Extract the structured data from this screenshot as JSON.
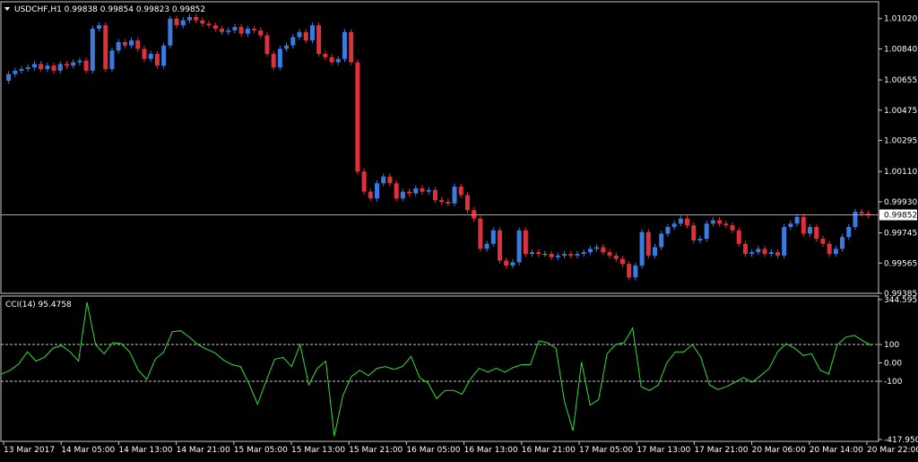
{
  "symbol_header": "USDCHF,H1  0.99838 0.99854 0.99823 0.99852",
  "menu_icon": "triangle-down-icon",
  "indicator_header": "CCI(14) 95.4758",
  "colors": {
    "background": "#000000",
    "bull": "#3a7be0",
    "bear": "#e0303a",
    "doji": "#34c334",
    "cci_line": "#33dd33",
    "grid_border": "#c8c8c8",
    "price_line": "#9aa7b8",
    "price_tag_bg": "#ffffff",
    "price_tag_text": "#000000"
  },
  "chart_data": [
    {
      "type": "candlestick",
      "title": "USDCHF,H1",
      "ylim": [
        0.99385,
        1.0112
      ],
      "y_ticks": [
        "1.01020",
        "1.00840",
        "1.00655",
        "1.00475",
        "1.00295",
        "1.00110",
        "0.99930",
        "0.99745",
        "0.99565",
        "0.99385"
      ],
      "current_price": "0.99852",
      "x_ticks": [
        "13 Mar 2017",
        "14 Mar 05:00",
        "14 Mar 13:00",
        "14 Mar 21:00",
        "15 Mar 05:00",
        "15 Mar 13:00",
        "15 Mar 21:00",
        "16 Mar 05:00",
        "16 Mar 13:00",
        "16 Mar 21:00",
        "17 Mar 05:00",
        "17 Mar 13:00",
        "17 Mar 21:00",
        "20 Mar 06:00",
        "20 Mar 14:00",
        "20 Mar 22:00"
      ],
      "closes": [
        1.0069,
        1.0071,
        1.0072,
        1.0073,
        1.0075,
        1.0072,
        1.0074,
        1.0071,
        1.0075,
        1.0074,
        1.0076,
        1.0077,
        1.0071,
        1.0096,
        1.0098,
        1.0072,
        1.0083,
        1.0088,
        1.0086,
        1.0089,
        1.0084,
        1.0078,
        1.0081,
        1.0074,
        1.0086,
        1.0102,
        1.0098,
        1.0101,
        1.0103,
        1.0101,
        1.0099,
        1.0098,
        1.0096,
        1.0094,
        1.0095,
        1.0097,
        1.0093,
        1.0096,
        1.0095,
        1.0092,
        1.0081,
        1.0073,
        1.0084,
        1.0086,
        1.0091,
        1.0094,
        1.0089,
        1.0098,
        1.0081,
        1.0079,
        1.0076,
        1.0078,
        1.0094,
        1.0076,
        1.0011,
        0.9999,
        0.9995,
        1.0004,
        1.0008,
        1.0004,
        0.9995,
        0.9999,
        0.9998,
        1.0001,
        0.9999,
        1.0,
        0.9994,
        0.9993,
        0.9992,
        1.0002,
        0.9997,
        0.9988,
        0.9983,
        0.9965,
        0.9968,
        0.9976,
        0.9958,
        0.9955,
        0.9957,
        0.9976,
        0.9962,
        0.9963,
        0.9962,
        0.9962,
        0.996,
        0.9961,
        0.9962,
        0.9961,
        0.9962,
        0.9963,
        0.9965,
        0.9966,
        0.9963,
        0.9961,
        0.9959,
        0.9956,
        0.9948,
        0.9955,
        0.9975,
        0.9961,
        0.9966,
        0.9974,
        0.9978,
        0.998,
        0.9983,
        0.9979,
        0.997,
        0.9971,
        0.998,
        0.9982,
        0.998,
        0.9979,
        0.9976,
        0.9968,
        0.9962,
        0.9963,
        0.9965,
        0.9962,
        0.9963,
        0.9961,
        0.9978,
        0.998,
        0.9984,
        0.9974,
        0.9978,
        0.9971,
        0.9968,
        0.9962,
        0.9965,
        0.9972,
        0.9978,
        0.9987,
        0.9986,
        0.9985
      ],
      "opens_first": 1.0065
    },
    {
      "type": "line",
      "title": "CCI(14) 95.4758",
      "ylim": [
        -417.9504,
        344.5951
      ],
      "y_ticks": [
        "344.5951",
        "100",
        "0.00",
        "-100",
        "-417.9504"
      ],
      "levels": [
        100,
        -100
      ],
      "values": [
        -60,
        -40,
        -5,
        60,
        10,
        30,
        80,
        95,
        60,
        10,
        330,
        100,
        50,
        110,
        105,
        60,
        -40,
        -90,
        20,
        60,
        170,
        175,
        140,
        100,
        75,
        55,
        15,
        -10,
        -20,
        -115,
        -225,
        -100,
        20,
        30,
        -20,
        100,
        -120,
        -30,
        10,
        -400,
        -180,
        -75,
        -40,
        -70,
        -30,
        -20,
        -35,
        -20,
        35,
        -80,
        -110,
        -195,
        -150,
        -150,
        -170,
        -85,
        -30,
        -50,
        -30,
        -50,
        -25,
        -10,
        -10,
        120,
        110,
        80,
        -210,
        -370,
        5,
        -230,
        -200,
        50,
        100,
        110,
        190,
        -130,
        -150,
        -120,
        0,
        60,
        60,
        100,
        30,
        -120,
        -145,
        -130,
        -105,
        -80,
        -105,
        -70,
        -30,
        60,
        105,
        80,
        40,
        50,
        -40,
        -60,
        100,
        140,
        150,
        120,
        95
      ]
    }
  ]
}
